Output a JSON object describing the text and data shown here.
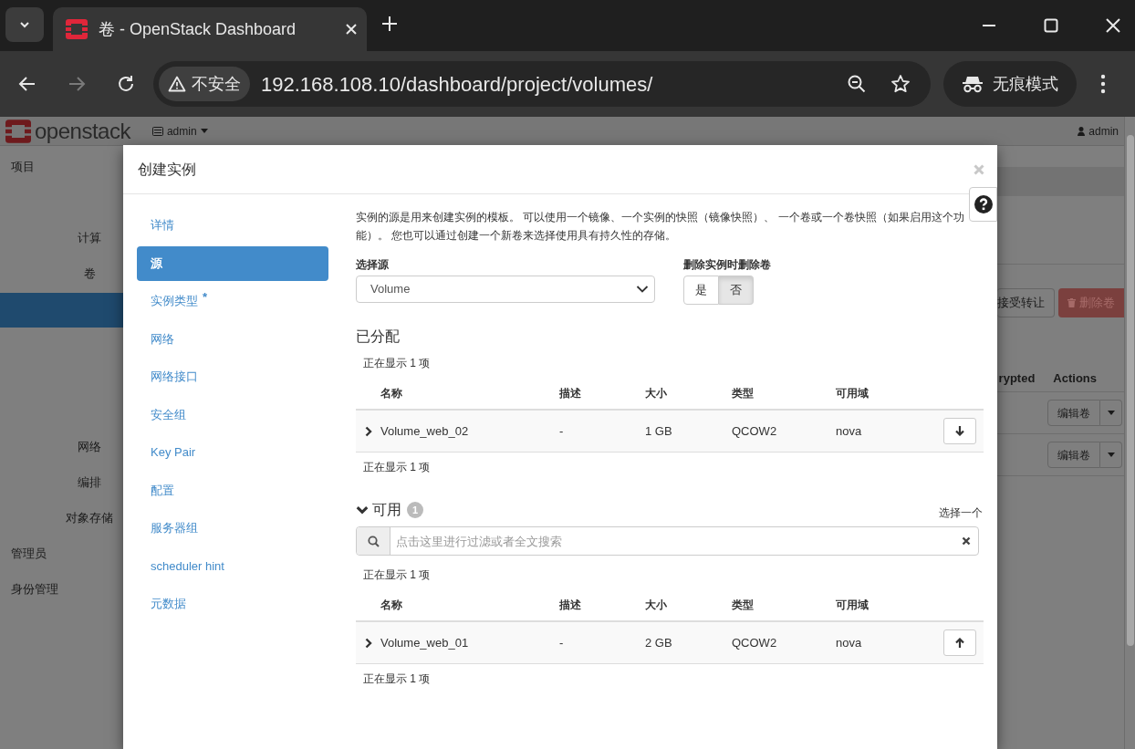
{
  "browser": {
    "tab_title": "卷 - OpenStack Dashboard",
    "security_label": "不安全",
    "url": "192.168.108.10/dashboard/project/volumes/",
    "profile_label": "无痕模式"
  },
  "background_page": {
    "brand": "openstack",
    "project": "admin",
    "user": "admin",
    "sidebar": [
      {
        "label": "项目",
        "children": [
          {
            "label": "计算"
          },
          {
            "label": "卷"
          },
          {
            "label": "网络"
          },
          {
            "label": "编排"
          },
          {
            "label": "对象存储"
          }
        ]
      },
      {
        "label": "管理员"
      },
      {
        "label": "身份管理"
      }
    ],
    "toolbar_buttons": [
      {
        "label": "接受转让",
        "kind": "default"
      },
      {
        "label": "删除卷",
        "kind": "danger"
      }
    ],
    "table_columns": [
      "rypted",
      "Actions"
    ],
    "row_actions": [
      "编辑卷",
      "编辑卷"
    ]
  },
  "modal": {
    "title": "创建实例",
    "nav": [
      {
        "label": "详情",
        "selected": false
      },
      {
        "label": "源",
        "selected": true
      },
      {
        "label": "实例类型",
        "selected": false,
        "required_mark": "*"
      },
      {
        "label": "网络",
        "selected": false
      },
      {
        "label": "网络接口",
        "selected": false
      },
      {
        "label": "安全组",
        "selected": false
      },
      {
        "label": "Key Pair",
        "selected": false
      },
      {
        "label": "配置",
        "selected": false
      },
      {
        "label": "服务器组",
        "selected": false
      },
      {
        "label": "scheduler hint",
        "selected": false
      },
      {
        "label": "元数据",
        "selected": false
      }
    ],
    "description": "实例的源是用来创建实例的模板。 可以使用一个镜像、一个实例的快照（镜像快照）、 一个卷或一个卷快照（如果启用这个功能）。 您也可以通过创建一个新卷来选择使用具有持久性的存储。",
    "source_field": {
      "label": "选择源",
      "value": "Volume"
    },
    "delete_toggle": {
      "label": "删除实例时删除卷",
      "options": [
        {
          "label": "是",
          "selected": false
        },
        {
          "label": "否",
          "selected": true
        }
      ]
    },
    "allocated": {
      "title": "已分配",
      "count_text": "正在显示 1 项",
      "columns": [
        "名称",
        "描述",
        "大小",
        "类型",
        "可用域"
      ],
      "rows": [
        {
          "expanded": false,
          "name": "Volume_web_02",
          "description": "-",
          "size": "1 GB",
          "type": "QCOW2",
          "zone": "nova"
        }
      ],
      "footer": "正在显示 1 项"
    },
    "available": {
      "title": "可用",
      "expanded": true,
      "badge": "1",
      "hint": "选择一个",
      "search": {
        "placeholder": "点击这里进行过滤或者全文搜索"
      },
      "count_text": "正在显示 1 项",
      "columns": [
        "名称",
        "描述",
        "大小",
        "类型",
        "可用域"
      ],
      "rows": [
        {
          "expanded": false,
          "name": "Volume_web_01",
          "description": "-",
          "size": "2 GB",
          "type": "QCOW2",
          "zone": "nova"
        }
      ],
      "footer": "正在显示 1 项"
    }
  }
}
